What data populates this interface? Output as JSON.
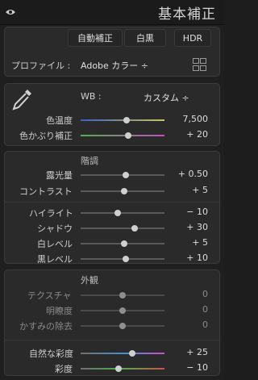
{
  "header": {
    "title": "基本補正"
  },
  "buttons": {
    "auto": "自動補正",
    "bw": "白黒",
    "hdr": "HDR"
  },
  "profile": {
    "label": "プロファイル :",
    "value": "Adobe カラー ÷"
  },
  "wb": {
    "label": "WB :",
    "value": "カスタム ÷"
  },
  "sections": {
    "tone": "階調",
    "presence": "外観"
  },
  "sliders": [
    {
      "label": "色温度",
      "value": "7,500",
      "position": 0.55
    },
    {
      "label": "色かぶり補正",
      "value": "+ 20",
      "position": 0.57
    },
    {
      "label": "露光量",
      "value": "+ 0.50",
      "position": 0.54
    },
    {
      "label": "コントラスト",
      "value": "+ 5",
      "position": 0.52
    },
    {
      "label": "ハイライト",
      "value": "− 10",
      "position": 0.44
    },
    {
      "label": "シャドウ",
      "value": "+ 30",
      "position": 0.64
    },
    {
      "label": "白レベル",
      "value": "+ 5",
      "position": 0.52
    },
    {
      "label": "黒レベル",
      "value": "+ 10",
      "position": 0.54
    },
    {
      "label": "テクスチャ",
      "value": "0",
      "position": 0.5
    },
    {
      "label": "明瞭度",
      "value": "0",
      "position": 0.5
    },
    {
      "label": "かすみの除去",
      "value": "0",
      "position": 0.5
    },
    {
      "label": "自然な彩度",
      "value": "+ 25",
      "position": 0.62
    },
    {
      "label": "彩度",
      "value": "− 10",
      "position": 0.45
    }
  ]
}
